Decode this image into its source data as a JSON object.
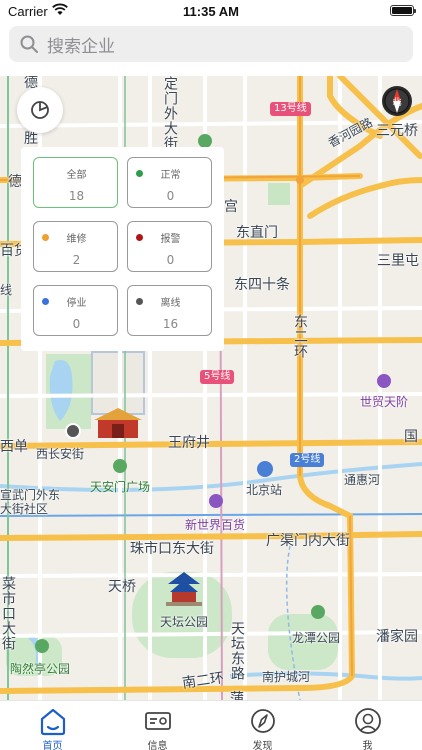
{
  "status_bar": {
    "carrier": "Carrier",
    "time": "11:35 AM"
  },
  "search": {
    "placeholder": "搜索企业"
  },
  "map": {
    "labels": {
      "de": "德",
      "sheng": "胜",
      "dingmen": "定门外大街",
      "line13": "13号线",
      "sanyuanqiao": "三元桥",
      "de2": "德",
      "baihuo": "百货",
      "xian": "线",
      "xiangheyuan": "香河园路",
      "gong": "宫",
      "dongzhimen": "东直门",
      "sanlitun": "三里屯",
      "dongsishitiao": "东四十条",
      "dongerhuan": "东二环",
      "line5": "5号线",
      "shimao": "世贸天阶",
      "guo": "国",
      "xidan": "西单",
      "xichangan": "西长安街",
      "wangfujing": "王府井",
      "line2": "2号线",
      "tonghuihe": "通惠河",
      "tiananmen": "天安门广场",
      "beijingzhan": "北京站",
      "xuanwu": "宣武门外东大街社区",
      "xinshijie": "新世界百货",
      "guangqumen": "广渠门内大街",
      "zhushikou": "珠市口东大街",
      "tianqiao": "天桥",
      "caishikou": "菜市口大街",
      "tiantan": "天坛公园",
      "tiantanlu": "天坛东路",
      "longtan": "龙潭公园",
      "panjiayuan": "潘家园",
      "taoranting": "陶然亭公园",
      "nanerhuan": "南二环",
      "nanhuchenghe": "南护城河",
      "pu": "蒲"
    },
    "compass_text": "北"
  },
  "filters": [
    {
      "label": "全部",
      "count": "18",
      "color": "",
      "selected": true
    },
    {
      "label": "正常",
      "count": "0",
      "color": "#2e9d4a",
      "selected": false
    },
    {
      "label": "维修",
      "count": "2",
      "color": "#f0a030",
      "selected": false
    },
    {
      "label": "报警",
      "count": "0",
      "color": "#b01515",
      "selected": false
    },
    {
      "label": "停业",
      "count": "0",
      "color": "#3a72d8",
      "selected": false
    },
    {
      "label": "离线",
      "count": "16",
      "color": "#555555",
      "selected": false
    }
  ],
  "tabs": [
    {
      "label": "首页",
      "icon": "home-icon",
      "active": true
    },
    {
      "label": "信息",
      "icon": "id-card-icon",
      "active": false
    },
    {
      "label": "发现",
      "icon": "compass-icon",
      "active": false
    },
    {
      "label": "我",
      "icon": "user-icon",
      "active": false
    }
  ],
  "colors": {
    "accent": "#1d5fc9",
    "selected_border": "#6cc27a",
    "road_yellow": "#f7c04a"
  }
}
